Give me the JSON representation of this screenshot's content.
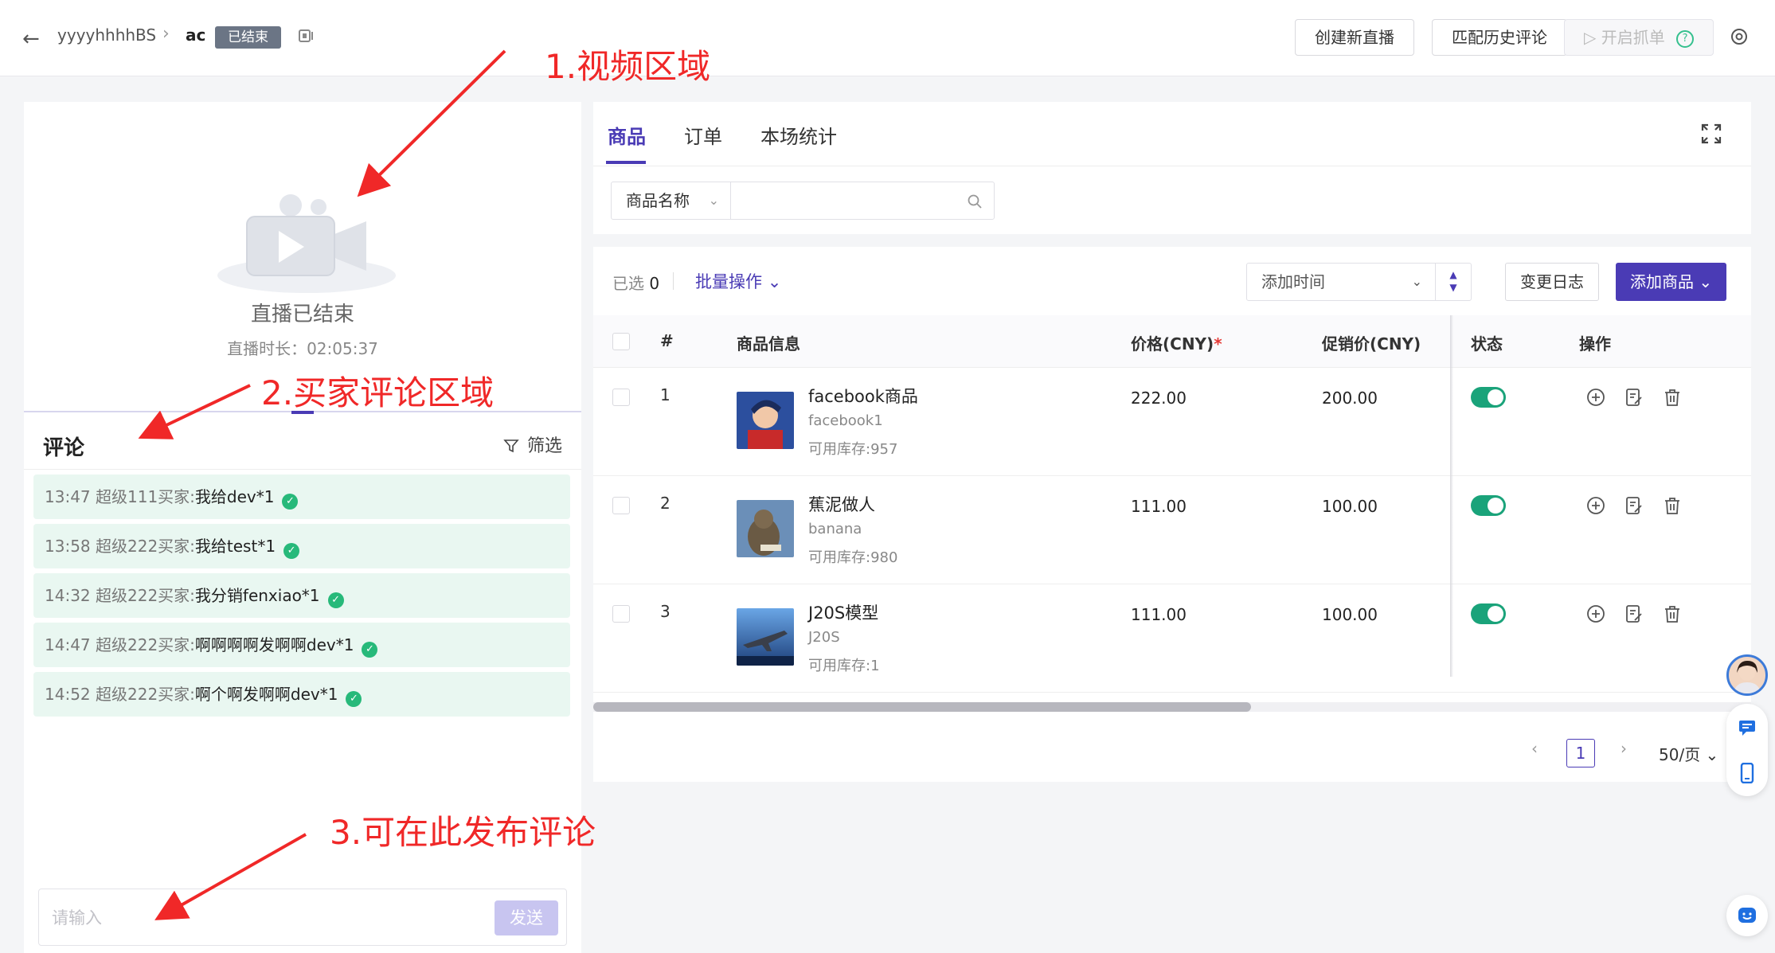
{
  "topbar": {
    "user": "yyyyhhhhBS",
    "room": "ac",
    "status": "已结束",
    "buttons": {
      "create": "创建新直播",
      "match": "匹配历史评论",
      "start": "开启抓单"
    }
  },
  "annotations": {
    "video": "1.视频区域",
    "comments": "2.买家评论区域",
    "post": "3.可在此发布评论"
  },
  "video": {
    "status": "直播已结束",
    "duration": "直播时长：02:05:37"
  },
  "comments": {
    "title": "评论",
    "filter": "筛选",
    "items": [
      {
        "meta": "13:47 超级111买家:",
        "msg": "我给dev*1"
      },
      {
        "meta": "13:58 超级222买家:",
        "msg": "我给test*1"
      },
      {
        "meta": "14:32 超级222买家:",
        "msg": "我分销fenxiao*1"
      },
      {
        "meta": "14:47 超级222买家:",
        "msg": "啊啊啊啊发啊啊dev*1"
      },
      {
        "meta": "14:52 超级222买家:",
        "msg": "啊个啊发啊啊dev*1"
      }
    ],
    "input_placeholder": "请输入",
    "send": "发送"
  },
  "tabs": [
    "商品",
    "订单",
    "本场统计"
  ],
  "search": {
    "field": "商品名称",
    "placeholder": ""
  },
  "toolbar": {
    "selected_label": "已选",
    "selected_count": "0",
    "bulk": "批量操作",
    "sort": "添加时间",
    "changelog": "变更日志",
    "add": "添加商品"
  },
  "table": {
    "headers": {
      "index": "#",
      "info": "商品信息",
      "price": "价格(CNY)",
      "price_required": "*",
      "promo": "促销价(CNY)",
      "status": "状态",
      "ops": "操作"
    },
    "rows": [
      {
        "index": "1",
        "name": "facebook商品",
        "sub": "facebook1",
        "stock": "可用库存:957",
        "price": "222.00",
        "promo": "200.00",
        "enabled": true
      },
      {
        "index": "2",
        "name": "蕉泥做人",
        "sub": "banana",
        "stock": "可用库存:980",
        "price": "111.00",
        "promo": "100.00",
        "enabled": true
      },
      {
        "index": "3",
        "name": "J20S模型",
        "sub": "J20S",
        "stock": "可用库存:1",
        "price": "111.00",
        "promo": "100.00",
        "enabled": true
      }
    ]
  },
  "pagination": {
    "current": "1",
    "page_size": "50/页"
  },
  "colors": {
    "accent": "#4a3bb5",
    "success": "#1aa37a",
    "annotation": "#f02828"
  }
}
